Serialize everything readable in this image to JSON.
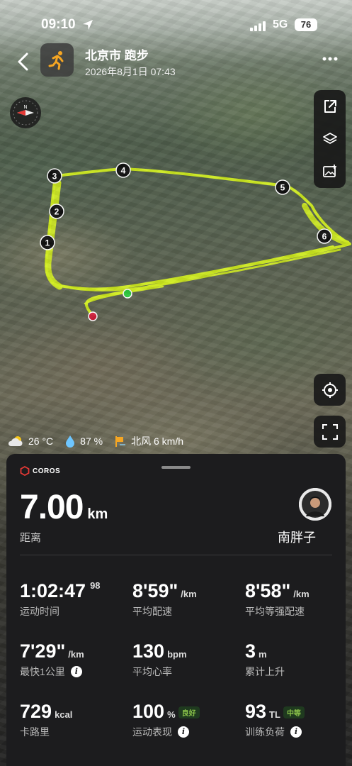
{
  "status_bar": {
    "time": "09:10",
    "network": "5G",
    "battery": "76"
  },
  "header": {
    "title": "北京市 跑步",
    "datetime": "2026年8月1日 07:43"
  },
  "route": {
    "markers": [
      "1",
      "2",
      "3",
      "4",
      "5",
      "6"
    ],
    "route_color": "#d4f01e",
    "start_color": "#2ecc40",
    "end_color": "#d0203a"
  },
  "weather": {
    "temperature": "26 °C",
    "humidity": "87 %",
    "wind": "北风 6 km/h"
  },
  "panel": {
    "brand": "COROS",
    "distance": {
      "value": "7.00",
      "unit": "km",
      "label": "距离"
    },
    "user_name": "南胖子",
    "stats": [
      {
        "value": "1:02:47",
        "sup": "98",
        "unit": "",
        "label": "运动时间"
      },
      {
        "value": "8'59\"",
        "unit": "/km",
        "label": "平均配速"
      },
      {
        "value": "8'58\"",
        "unit": "/km",
        "label": "平均等强配速"
      },
      {
        "value": "7'29\"",
        "unit": "/km",
        "label": "最快1公里"
      },
      {
        "value": "130",
        "unit": "bpm",
        "label": "平均心率"
      },
      {
        "value": "3",
        "unit": "m",
        "label": "累计上升"
      },
      {
        "value": "729",
        "unit": "kcal",
        "label": "卡路里"
      },
      {
        "value": "100",
        "unit": "%",
        "badge": "良好",
        "label": "运动表现"
      },
      {
        "value": "93",
        "unit": "TL",
        "badge": "中等",
        "label": "训练负荷"
      }
    ]
  }
}
